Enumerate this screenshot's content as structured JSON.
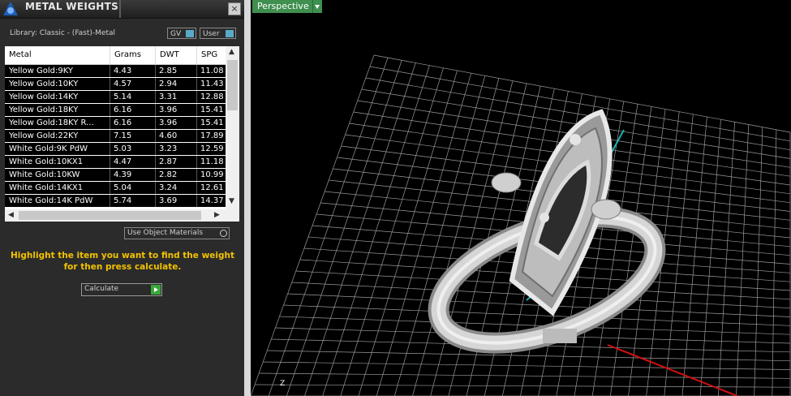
{
  "panel": {
    "title": "METAL WEIGHTS",
    "close_glyph": "×",
    "library_label": "Library: Classic - (Fast)-Metal",
    "toggles": [
      {
        "label": "GV"
      },
      {
        "label": "User"
      }
    ],
    "columns": [
      "Metal",
      "Grams",
      "DWT",
      "SPG"
    ],
    "rows": [
      [
        "Yellow Gold:9KY",
        "4.43",
        "2.85",
        "11.08"
      ],
      [
        "Yellow Gold:10KY",
        "4.57",
        "2.94",
        "11.43"
      ],
      [
        "Yellow Gold:14KY",
        "5.14",
        "3.31",
        "12.88"
      ],
      [
        "Yellow Gold:18KY",
        "6.16",
        "3.96",
        "15.41"
      ],
      [
        "Yellow Gold:18KY R...",
        "6.16",
        "3.96",
        "15.41"
      ],
      [
        "Yellow Gold:22KY",
        "7.15",
        "4.60",
        "17.89"
      ],
      [
        "White Gold:9K PdW",
        "5.03",
        "3.23",
        "12.59"
      ],
      [
        "White Gold:10KX1",
        "4.47",
        "2.87",
        "11.18"
      ],
      [
        "White Gold:10KW",
        "4.39",
        "2.82",
        "10.99"
      ],
      [
        "White Gold:14KX1",
        "5.04",
        "3.24",
        "12.61"
      ],
      [
        "White Gold:14K PdW",
        "5.74",
        "3.69",
        "14.37"
      ]
    ],
    "use_object_materials": "Use Object Materials",
    "hint_line1": "Highlight the item you want to find the weight",
    "hint_line2": "for then press calculate.",
    "calculate_label": "Calculate"
  },
  "viewport": {
    "view_label": "Perspective",
    "axis_label": "Z",
    "grid_color": "#9a9a9a",
    "x_axis_color": "#d01010",
    "y_axis_color": "#20b0b0",
    "model_color": "#cfcfcf"
  }
}
